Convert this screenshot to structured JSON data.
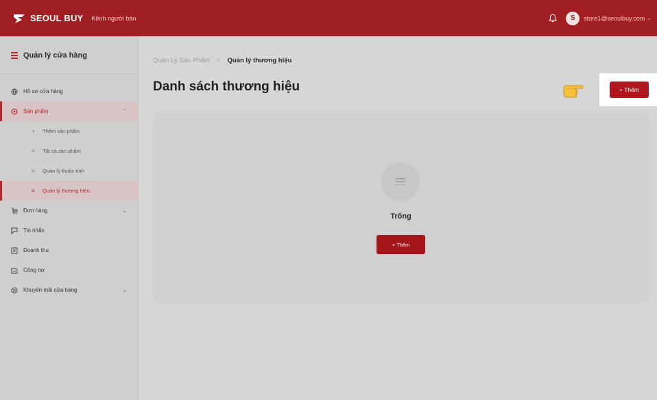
{
  "colors": {
    "brand": "#a01e22",
    "accent_button": "#b0171d",
    "overlay_bg": "#d6d6d6",
    "highlight": "#ffffff"
  },
  "header": {
    "logo_text": "SEOUL BUY",
    "tagline": "Kênh người bán",
    "bell_icon": "bell-icon",
    "avatar_letter": "S",
    "user_email": "store1@seoulbuy.com",
    "caret": "⌄"
  },
  "sidebar": {
    "title": "Quản lý cửa hàng",
    "items": [
      {
        "label": "Hồ sơ cửa hàng",
        "icon": "globe-icon"
      },
      {
        "label": "Sản phẩm",
        "icon": "gear-icon",
        "chevron": "⌃"
      },
      {
        "label": "Đơn hàng",
        "icon": "cart-icon",
        "chevron": "⌄"
      },
      {
        "label": "Tin nhắn",
        "icon": "chat-icon"
      },
      {
        "label": "Doanh thu",
        "icon": "revenue-icon"
      },
      {
        "label": "Công nợ",
        "icon": "debt-icon"
      },
      {
        "label": "Khuyến mãi cửa hàng",
        "icon": "promo-icon",
        "chevron": "⌄"
      }
    ],
    "sub_items": [
      {
        "label": "Thêm sản phẩm",
        "glyph": "+"
      },
      {
        "label": "Tất cả sản phẩm",
        "glyph": "≡"
      },
      {
        "label": "Quản lý thuộc tính",
        "glyph": "≡"
      },
      {
        "label": "Quản lý thương hiệu",
        "glyph": "≡"
      }
    ]
  },
  "breadcrumb": {
    "parent": "Quản Lý Sản Phẩm",
    "separator": ">",
    "current": "Quản lý thương hiệu"
  },
  "page": {
    "title": "Danh sách thương hiệu",
    "add_button": "+ Thêm"
  },
  "empty_state": {
    "text": "Trống",
    "add_button": "+ Thêm"
  }
}
